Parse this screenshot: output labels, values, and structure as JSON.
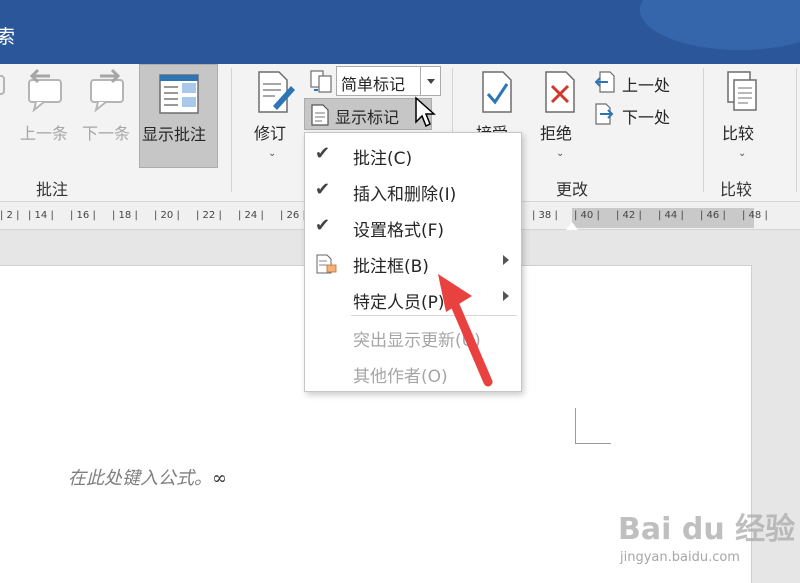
{
  "window": {
    "title_fragment": "索"
  },
  "ribbon": {
    "prev_comment": "上一条",
    "next_comment": "下一条",
    "show_comments": "显示批注",
    "track_changes": "修订",
    "markup_selector": "简单标记",
    "show_markup": "显示标记",
    "accept": "接受",
    "reject": "拒绝",
    "previous": "上一处",
    "next": "下一处",
    "compare": "比较",
    "groups": {
      "comments": "批注",
      "changes": "更改",
      "compare": "比较"
    }
  },
  "ruler": {
    "ticks": [
      "2",
      "14",
      "16",
      "18",
      "20",
      "22",
      "24",
      "26",
      "38",
      "40",
      "42",
      "44",
      "46",
      "48"
    ]
  },
  "menu": {
    "items": [
      {
        "label": "批注(C)",
        "checked": true,
        "enabled": true
      },
      {
        "label": "插入和删除(I)",
        "checked": true,
        "enabled": true
      },
      {
        "label": "设置格式(F)",
        "checked": true,
        "enabled": true
      },
      {
        "label": "批注框(B)",
        "icon": "comment-balloon-icon",
        "submenu": true,
        "enabled": true
      },
      {
        "label": "特定人员(P)",
        "submenu": true,
        "enabled": true
      },
      {
        "label": "突出显示更新(U)",
        "enabled": false
      },
      {
        "label": "其他作者(O)",
        "enabled": false
      }
    ]
  },
  "document": {
    "formula_placeholder": "在此处键入公式。",
    "formula_symbol": "∞"
  },
  "watermark": {
    "brand": "Bai du 经验",
    "url": "jingyan.baidu.com"
  },
  "colors": {
    "titlebar": "#2b579a",
    "annotation_arrow": "#e8413f"
  }
}
